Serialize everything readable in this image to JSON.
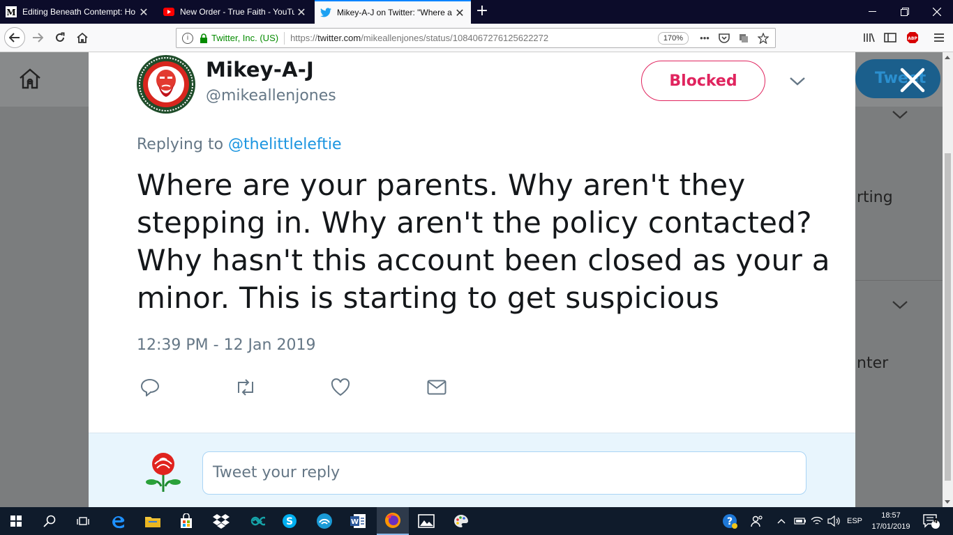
{
  "browser": {
    "tabs": [
      {
        "title": "Editing Beneath Contempt: Ho",
        "favicon": "medium-icon",
        "active": false
      },
      {
        "title": "New Order - True Faith - YouTu",
        "favicon": "youtube-icon",
        "active": false
      },
      {
        "title": "Mikey-A-J on Twitter: \"Where a",
        "favicon": "twitter-bird-icon",
        "active": true
      }
    ],
    "url": {
      "org": "Twitter, Inc. (US)",
      "prefix": "https://",
      "host": "twitter.com",
      "path": "/mikeallenjones/status/1084067276125622272",
      "zoom": "170%"
    }
  },
  "background": {
    "tweet_button": "Tweet",
    "side_text_1": "rting",
    "side_text_2": "nter"
  },
  "tweet": {
    "display_name": "Mikey-A-J",
    "handle": "@mikeallenjones",
    "follow_state": "Blocked",
    "replying_prefix": "Replying to ",
    "replying_to": "@thelittleleftie",
    "text_lines": [
      "Where are your parents. Why aren't they",
      "stepping in. Why aren't the policy contacted?",
      "Why hasn't this account been closed as your a",
      "minor. This is starting to get suspicious"
    ],
    "timestamp": "12:39 PM - 12 Jan 2019"
  },
  "reply": {
    "placeholder": "Tweet your reply"
  },
  "taskbar": {
    "language": "ESP",
    "time": "18:57",
    "date": "17/01/2019",
    "notifications": "4"
  },
  "colors": {
    "blocked": "#e0245e",
    "link": "#1b95e0",
    "muted": "#657786",
    "text": "#14171a"
  }
}
